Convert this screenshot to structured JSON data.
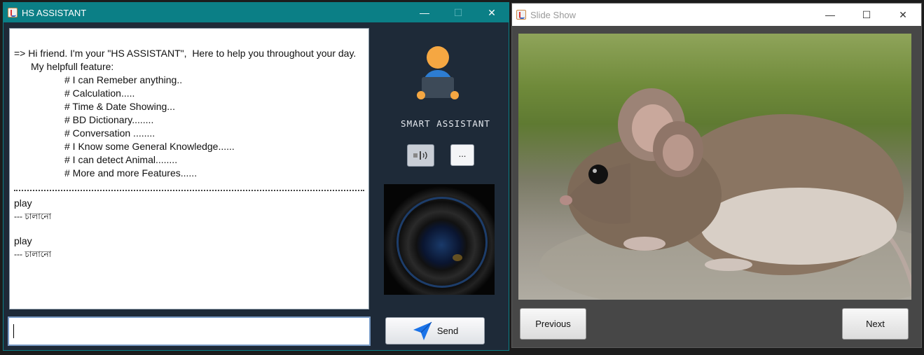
{
  "assistant_window": {
    "title": "HS ASSISTANT",
    "minimize_glyph": "—",
    "maximize_glyph": "☐",
    "close_glyph": "✕",
    "chat": {
      "intro": [
        "=> Hi friend. I'm your \"HS ASSISTANT\",  Here to help you throughout your day.",
        "My helpfull feature:"
      ],
      "features": [
        "# I can Remeber anything..",
        "# Calculation.....",
        "# Time & Date Showing...",
        "# BD Dictionary........",
        "# Conversation ........",
        "# I Know some General Knowledge......",
        "# I can detect Animal........",
        "# More and more Features......"
      ],
      "messages": [
        {
          "word": "play",
          "translation": "--- চালানো"
        },
        {
          "word": "play",
          "translation": "--- চালানো"
        }
      ]
    },
    "input": {
      "value": ""
    },
    "assistant_label": "SMART ASSISTANT",
    "more_button_label": "...",
    "send_button_label": "Send",
    "icons": {
      "mic": "voice-input-icon",
      "send": "paper-plane-icon",
      "avatar": "person-at-laptop-icon"
    },
    "colors": {
      "titlebar": "#0b7f86",
      "panel": "#1e2a38",
      "send_icon": "#1a73e8"
    }
  },
  "slideshow_window": {
    "title": "Slide Show",
    "minimize_glyph": "—",
    "maximize_glyph": "☐",
    "close_glyph": "✕",
    "image_subject": "mouse",
    "previous_label": "Previous",
    "next_label": "Next",
    "colors": {
      "background": "#474747"
    }
  }
}
